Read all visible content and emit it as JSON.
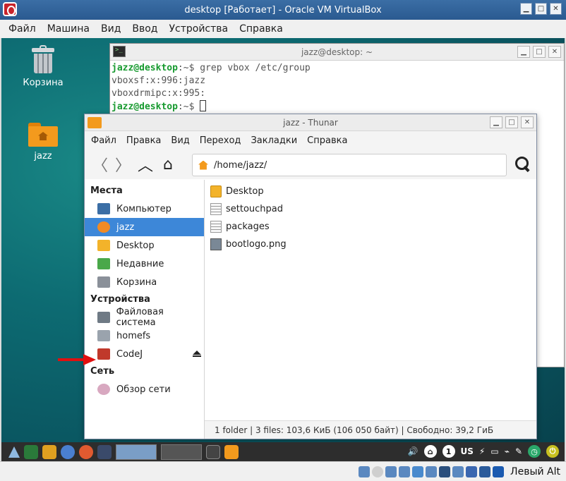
{
  "host": {
    "title": "desktop [Работает] - Oracle VM VirtualBox",
    "menu": [
      "Файл",
      "Машина",
      "Вид",
      "Ввод",
      "Устройства",
      "Справка"
    ],
    "host_key_label": "Левый Alt"
  },
  "desktop": {
    "icons": [
      {
        "label": "Корзина",
        "icon": "trash-icon"
      },
      {
        "label": "jazz",
        "icon": "home-folder-icon"
      }
    ]
  },
  "terminal": {
    "title": "jazz@desktop: ~",
    "lines": [
      {
        "prompt": "jazz@desktop",
        "rest": ":~$ grep vbox /etc/group"
      },
      {
        "text": "vboxsf:x:996:jazz"
      },
      {
        "text": "vboxdrmipc:x:995:"
      },
      {
        "prompt": "jazz@desktop",
        "rest": ":~$ "
      }
    ]
  },
  "thunar": {
    "title": "jazz - Thunar",
    "menu": [
      "Файл",
      "Правка",
      "Вид",
      "Переход",
      "Закладки",
      "Справка"
    ],
    "path": "/home/jazz/",
    "places_header": "Места",
    "places": [
      {
        "label": "Компьютер",
        "icon": "computer-icon",
        "color": "#3b6ea5"
      },
      {
        "label": "jazz",
        "icon": "home-icon",
        "color": "#f08a24",
        "active": true
      },
      {
        "label": "Desktop",
        "icon": "desktop-folder-icon",
        "color": "#f3b32a"
      },
      {
        "label": "Недавние",
        "icon": "recent-icon",
        "color": "#4aa84a"
      },
      {
        "label": "Корзина",
        "icon": "trash-icon",
        "color": "#8a9099"
      }
    ],
    "devices_header": "Устройства",
    "devices": [
      {
        "label": "Файловая система",
        "icon": "drive-icon",
        "color": "#6f7a85"
      },
      {
        "label": "homefs",
        "icon": "drive-icon",
        "color": "#9aa3ad"
      },
      {
        "label": "CodeJ",
        "icon": "usb-drive-icon",
        "color": "#c0392b",
        "eject": true
      }
    ],
    "network_header": "Сеть",
    "network": [
      {
        "label": "Обзор сети",
        "icon": "network-icon",
        "color": "#d8a8c0"
      }
    ],
    "files": [
      {
        "name": "Desktop",
        "icon": "desktop-folder-icon"
      },
      {
        "name": "settouchpad",
        "icon": "text-file-icon"
      },
      {
        "name": "packages",
        "icon": "text-file-icon"
      },
      {
        "name": "bootlogo.png",
        "icon": "image-file-icon"
      }
    ],
    "status": "1 folder  |  3 files: 103,6 КиБ (106 050 байт)  |  Свободно: 39,2 ГиБ"
  },
  "panel": {
    "keyboard_layout": "US",
    "workspace_number": "1"
  }
}
